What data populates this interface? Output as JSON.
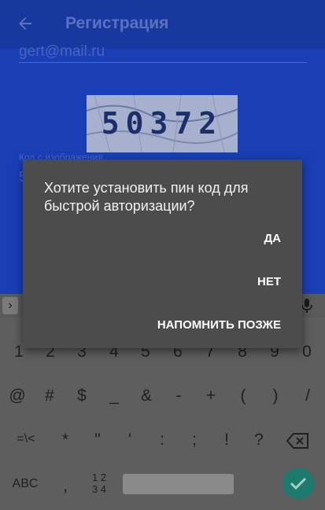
{
  "appbar": {
    "title": "Регистрация"
  },
  "form": {
    "email_value": "gert@mail.ru",
    "captcha_text": "50372",
    "code_label": "Код с изображения",
    "code_value": "5"
  },
  "dialog": {
    "message": "Хотите установить пин код для быстрой авторизации?",
    "yes_label": "ДА",
    "no_label": "НЕТ",
    "later_label": "НАПОМНИТЬ ПОЗЖЕ"
  },
  "keyboard": {
    "row_numbers": [
      "1",
      "2",
      "3",
      "4",
      "5",
      "6",
      "7",
      "8",
      "9",
      "0"
    ],
    "row_symbols1": [
      "@",
      "#",
      "$",
      "_",
      "&",
      "-",
      "+",
      "(",
      ")",
      "/"
    ],
    "row_symbols2": [
      "=\\<",
      "*",
      "\"",
      "'",
      ":",
      ";",
      "!",
      "?"
    ],
    "abc_label": "ABC",
    "comma": ",",
    "numpad_label_top": "1 2",
    "numpad_label_bottom": "3 4"
  },
  "colors": {
    "app_blue": "#1a3fb5",
    "dialog_bg": "#4c4c4c",
    "enter_green": "#1d7a6f"
  }
}
